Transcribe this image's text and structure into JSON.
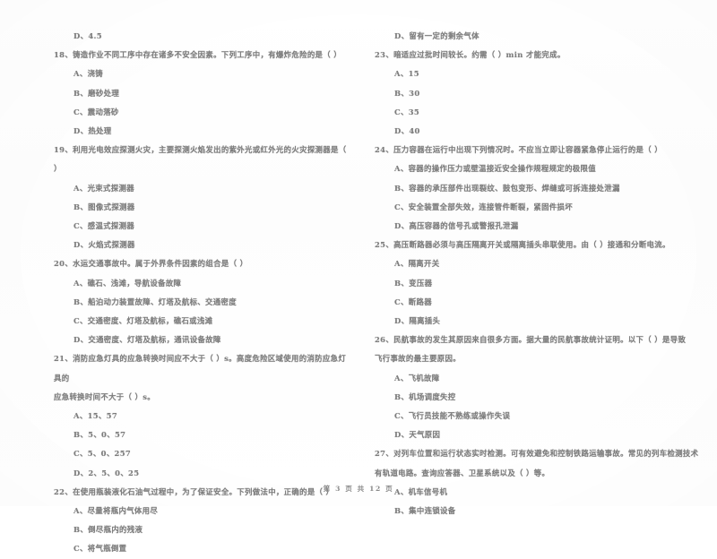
{
  "document": {
    "type": "exam-paper-scan",
    "footer": "第 3 页 共 12 页"
  },
  "left_column": {
    "blocks": [
      {
        "kind": "option",
        "text": "D、4.5"
      },
      {
        "kind": "stem",
        "text": "18、铸造作业不同工序中存在诸多不安全因素。下列工序中，有爆炸危险的是（        ）"
      },
      {
        "kind": "option",
        "text": "A、浇铸"
      },
      {
        "kind": "option",
        "text": "B、磨砂处理"
      },
      {
        "kind": "option",
        "text": "C、震动落砂"
      },
      {
        "kind": "option",
        "text": "D、热处理"
      },
      {
        "kind": "stem",
        "text": "19、利用光电效应探测火灾，主要探测火焰发出的紫外光或红外光的火灾探测器是（        ）"
      },
      {
        "kind": "option",
        "text": "A、光束式探测器"
      },
      {
        "kind": "option",
        "text": "B、图像式探测器"
      },
      {
        "kind": "option",
        "text": "C、感温式探测器"
      },
      {
        "kind": "option",
        "text": "D、火焰式探测器"
      },
      {
        "kind": "stem",
        "text": "20、水运交通事故中。属于外界条件因素的组合是（        ）"
      },
      {
        "kind": "option",
        "text": "A、礁石、浅滩，导航设备故障"
      },
      {
        "kind": "option",
        "text": "B、船泊动力装置故障、灯塔及航标、交通密度"
      },
      {
        "kind": "option",
        "text": "C、交通密度、灯塔及航标，礁石或浅滩"
      },
      {
        "kind": "option",
        "text": "D、交通密度、灯塔及航标，通讯设备故障"
      },
      {
        "kind": "stem",
        "text": "21、消防应急灯具的应急转换时间应不大于（        ）s。高度危险区域使用的消防应急灯具的"
      },
      {
        "kind": "stem-cont",
        "text": "应急转换时间不大于（       ）s。"
      },
      {
        "kind": "option",
        "text": "A、15、57"
      },
      {
        "kind": "option",
        "text": "B、5、0、57"
      },
      {
        "kind": "option",
        "text": "C、5、0、257"
      },
      {
        "kind": "option",
        "text": "D、2、5、0、25"
      },
      {
        "kind": "stem",
        "text": "22、在使用瓶装液化石油气过程中，为了保证安全。下列做法中，正确的是（        ）"
      },
      {
        "kind": "option",
        "text": "A、尽量将瓶内气体用尽"
      },
      {
        "kind": "option",
        "text": "B、倒尽瓶内的残液"
      },
      {
        "kind": "option",
        "text": "C、将气瓶倒置"
      }
    ]
  },
  "right_column": {
    "blocks": [
      {
        "kind": "option",
        "text": "D、留有一定的剩余气体"
      },
      {
        "kind": "stem",
        "text": "23、暗适应过批时间较长。约需（       ）min 才能完成。"
      },
      {
        "kind": "option",
        "text": "A、15"
      },
      {
        "kind": "option",
        "text": "B、30"
      },
      {
        "kind": "option",
        "text": "C、35"
      },
      {
        "kind": "option",
        "text": "D、40"
      },
      {
        "kind": "stem",
        "text": "24、压力容器在运行中出现下列情况时。不应当立即让容器紧急停止运行的是（        ）"
      },
      {
        "kind": "option",
        "text": "A、容器的操作压力或壁温接近安全操作规程规定的极限值"
      },
      {
        "kind": "option",
        "text": "B、容器的承压部件出现裂纹、鼓包变形、焊缝或可拆连接处泄漏"
      },
      {
        "kind": "option",
        "text": "C、安全装置全部失效，连接管件断裂，紧固件损坏"
      },
      {
        "kind": "option",
        "text": "D、高压容器的信号孔或警报孔泄漏"
      },
      {
        "kind": "stem",
        "text": "25、高压断路器必须与高压隔离开关或隔离插头串联使用。由（       ）接通和分断电流。"
      },
      {
        "kind": "option",
        "text": "A、隔离开关"
      },
      {
        "kind": "option",
        "text": "B、变压器"
      },
      {
        "kind": "option",
        "text": "C、断路器"
      },
      {
        "kind": "option",
        "text": "D、隔离插头"
      },
      {
        "kind": "stem",
        "text": "26、民航事故的发生其原因来自很多方面。据大量的民航事故统计证明。以下（        ）是导致"
      },
      {
        "kind": "stem-cont",
        "text": "飞行事故的最主要原因。"
      },
      {
        "kind": "option",
        "text": "A、飞机故障"
      },
      {
        "kind": "option",
        "text": "B、机场调度失控"
      },
      {
        "kind": "option",
        "text": "C、飞行员技能不熟练或操作失误"
      },
      {
        "kind": "option",
        "text": "D、天气原因"
      },
      {
        "kind": "stem",
        "text": "27、对列车位置和运行状态实时检测。可有效避免和控制铁路运输事故。常见的列车检测技术"
      },
      {
        "kind": "stem-cont",
        "text": "有轨道电路。查询应答器、卫星系统以及（       ）等。"
      },
      {
        "kind": "option",
        "text": "A、机车信号机"
      },
      {
        "kind": "option",
        "text": "B、集中连锁设备"
      }
    ]
  }
}
